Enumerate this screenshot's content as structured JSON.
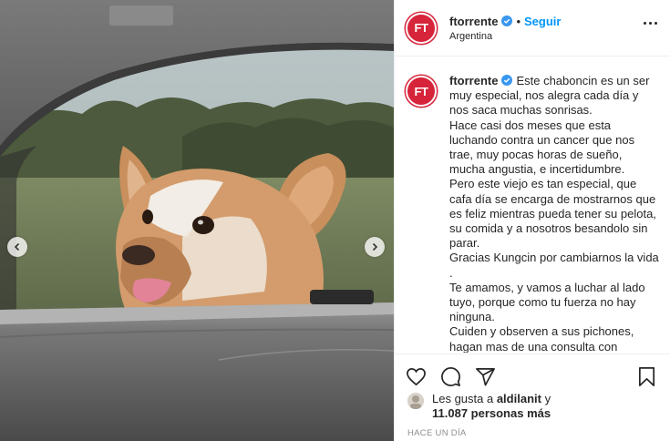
{
  "post": {
    "username": "ftorrente",
    "avatar_initials": "FT",
    "follow_label": "Seguir",
    "dot": "•",
    "location": "Argentina",
    "caption": "Este chaboncin es un ser muy especial, nos alegra cada día y nos saca muchas sonrisas.\nHace casi dos meses que esta luchando contra un cancer que nos trae, muy pocas horas de sueño, mucha angustia, e incertidumbre.\nPero este viejo es tan especial, que cafa día se encarga de mostrarnos que es feliz mientras pueda tener su pelota, su comida y a nosotros besandolo sin parar.\nGracias Kungcin por cambiarnos la vida .\nTe amamos, y vamos a luchar al lado tuyo, porque como tu fuerza no hay ninguna.\nCuiden y observen a sus pichones, hagan mas de una consulta con",
    "likes_prefix": "Les gusta a ",
    "likes_user": "aldilanit",
    "likes_mid": " y",
    "likes_count": "11.087 personas más",
    "time_ago": "HACE UN DÍA"
  },
  "icons": {
    "verified": "verified-badge-icon",
    "more": "more-options-icon",
    "like": "heart-icon",
    "comment": "comment-icon",
    "share": "paper-plane-icon",
    "save": "bookmark-icon",
    "prev": "chevron-left-icon",
    "next": "chevron-right-icon"
  },
  "colors": {
    "brand_red": "#d6243a",
    "link_blue": "#0095f6",
    "verified_blue": "#3897f0",
    "text": "#262626",
    "muted": "#8e8e8e"
  }
}
